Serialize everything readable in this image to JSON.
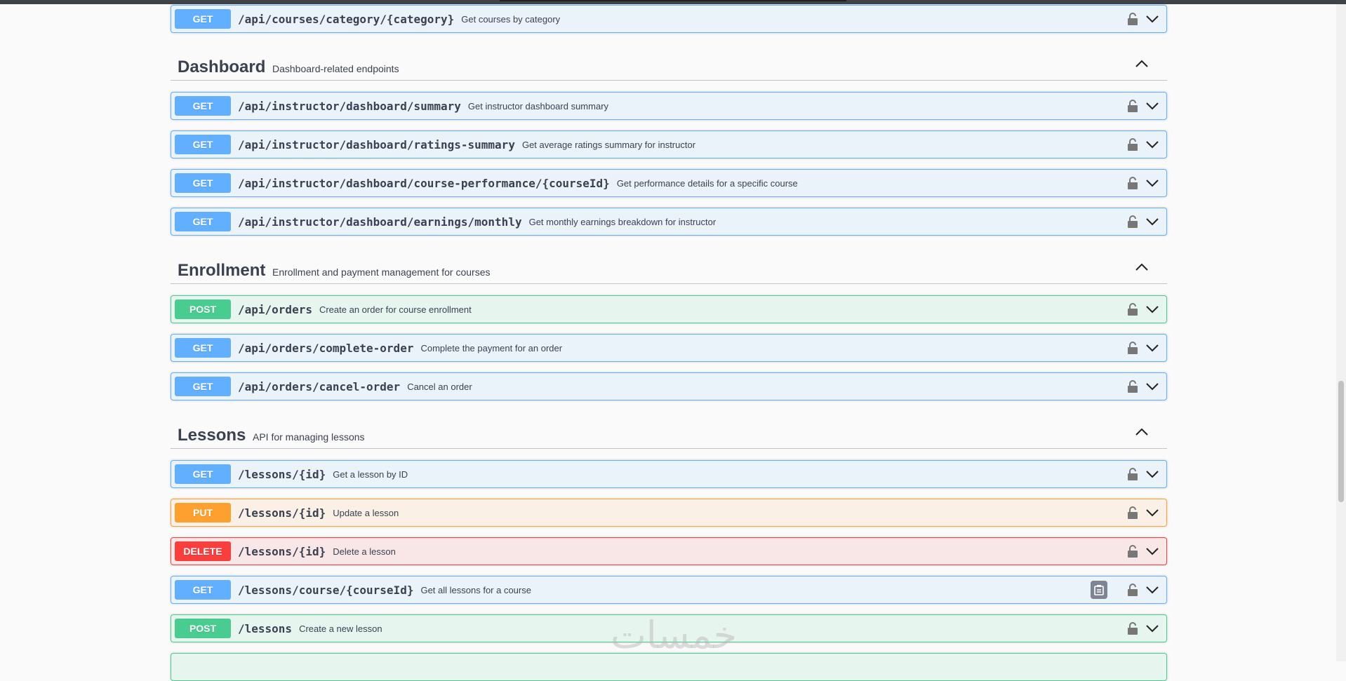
{
  "colors": {
    "get": "#61affe",
    "post": "#49cc90",
    "put": "#fca130",
    "delete": "#f93e3e",
    "text": "#3b4151"
  },
  "icons": {
    "lock": "lock-icon",
    "expand": "chevron-down-icon",
    "collapse": "chevron-up-icon",
    "copy": "clipboard-icon"
  },
  "top_operation": {
    "method": "GET",
    "path": "/api/courses/category/{category}",
    "summary": "Get courses by category"
  },
  "sections": [
    {
      "name": "Dashboard",
      "description": "Dashboard-related endpoints",
      "operations": [
        {
          "method": "GET",
          "path": "/api/instructor/dashboard/summary",
          "summary": "Get instructor dashboard summary"
        },
        {
          "method": "GET",
          "path": "/api/instructor/dashboard/ratings-summary",
          "summary": "Get average ratings summary for instructor"
        },
        {
          "method": "GET",
          "path": "/api/instructor/dashboard/course-performance/{courseId}",
          "summary": "Get performance details for a specific course"
        },
        {
          "method": "GET",
          "path": "/api/instructor/dashboard/earnings/monthly",
          "summary": "Get monthly earnings breakdown for instructor"
        }
      ]
    },
    {
      "name": "Enrollment",
      "description": "Enrollment and payment management for courses",
      "operations": [
        {
          "method": "POST",
          "path": "/api/orders",
          "summary": "Create an order for course enrollment"
        },
        {
          "method": "GET",
          "path": "/api/orders/complete-order",
          "summary": "Complete the payment for an order"
        },
        {
          "method": "GET",
          "path": "/api/orders/cancel-order",
          "summary": "Cancel an order"
        }
      ]
    },
    {
      "name": "Lessons",
      "description": "API for managing lessons",
      "operations": [
        {
          "method": "GET",
          "path": "/lessons/{id}",
          "summary": "Get a lesson by ID"
        },
        {
          "method": "PUT",
          "path": "/lessons/{id}",
          "summary": "Update a lesson"
        },
        {
          "method": "DELETE",
          "path": "/lessons/{id}",
          "summary": "Delete a lesson"
        },
        {
          "method": "GET",
          "path": "/lessons/course/{courseId}",
          "summary": "Get all lessons for a course"
        },
        {
          "method": "POST",
          "path": "/lessons",
          "summary": "Create a new lesson"
        }
      ]
    }
  ],
  "watermark": "خمسات"
}
